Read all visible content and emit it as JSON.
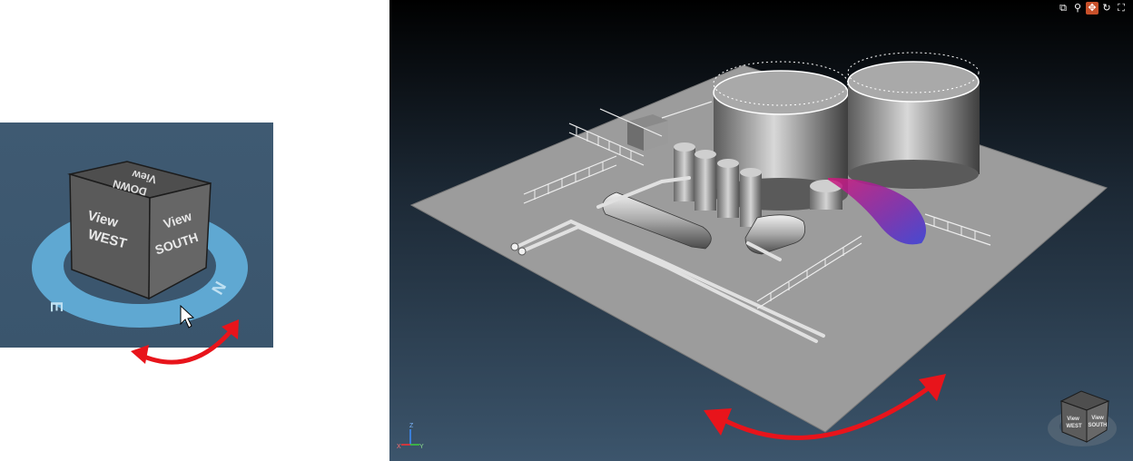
{
  "view_cube": {
    "faces": {
      "west": [
        "View",
        "WEST"
      ],
      "south": [
        "View",
        "SOUTH"
      ],
      "top": [
        "View",
        "DOWN"
      ]
    },
    "compass": {
      "left": "E",
      "right": "N"
    }
  },
  "mini_cube": {
    "faces": {
      "west": [
        "View",
        "WEST"
      ],
      "south": [
        "View",
        "SOUTH"
      ]
    }
  },
  "axes": {
    "x": "X",
    "y": "Y",
    "z": "Z"
  },
  "toolbar": {
    "buttons": [
      {
        "name": "zoom-window",
        "glyph": "⧉"
      },
      {
        "name": "zoom",
        "glyph": "⚲"
      },
      {
        "name": "pan",
        "glyph": "✥",
        "active": true
      },
      {
        "name": "rotate",
        "glyph": "↻"
      },
      {
        "name": "fullscreen",
        "glyph": "⛶"
      }
    ]
  },
  "colors": {
    "accent_arrow": "#e8141b",
    "pan_active": "#c8502a",
    "ring": "#5fa8d2"
  }
}
